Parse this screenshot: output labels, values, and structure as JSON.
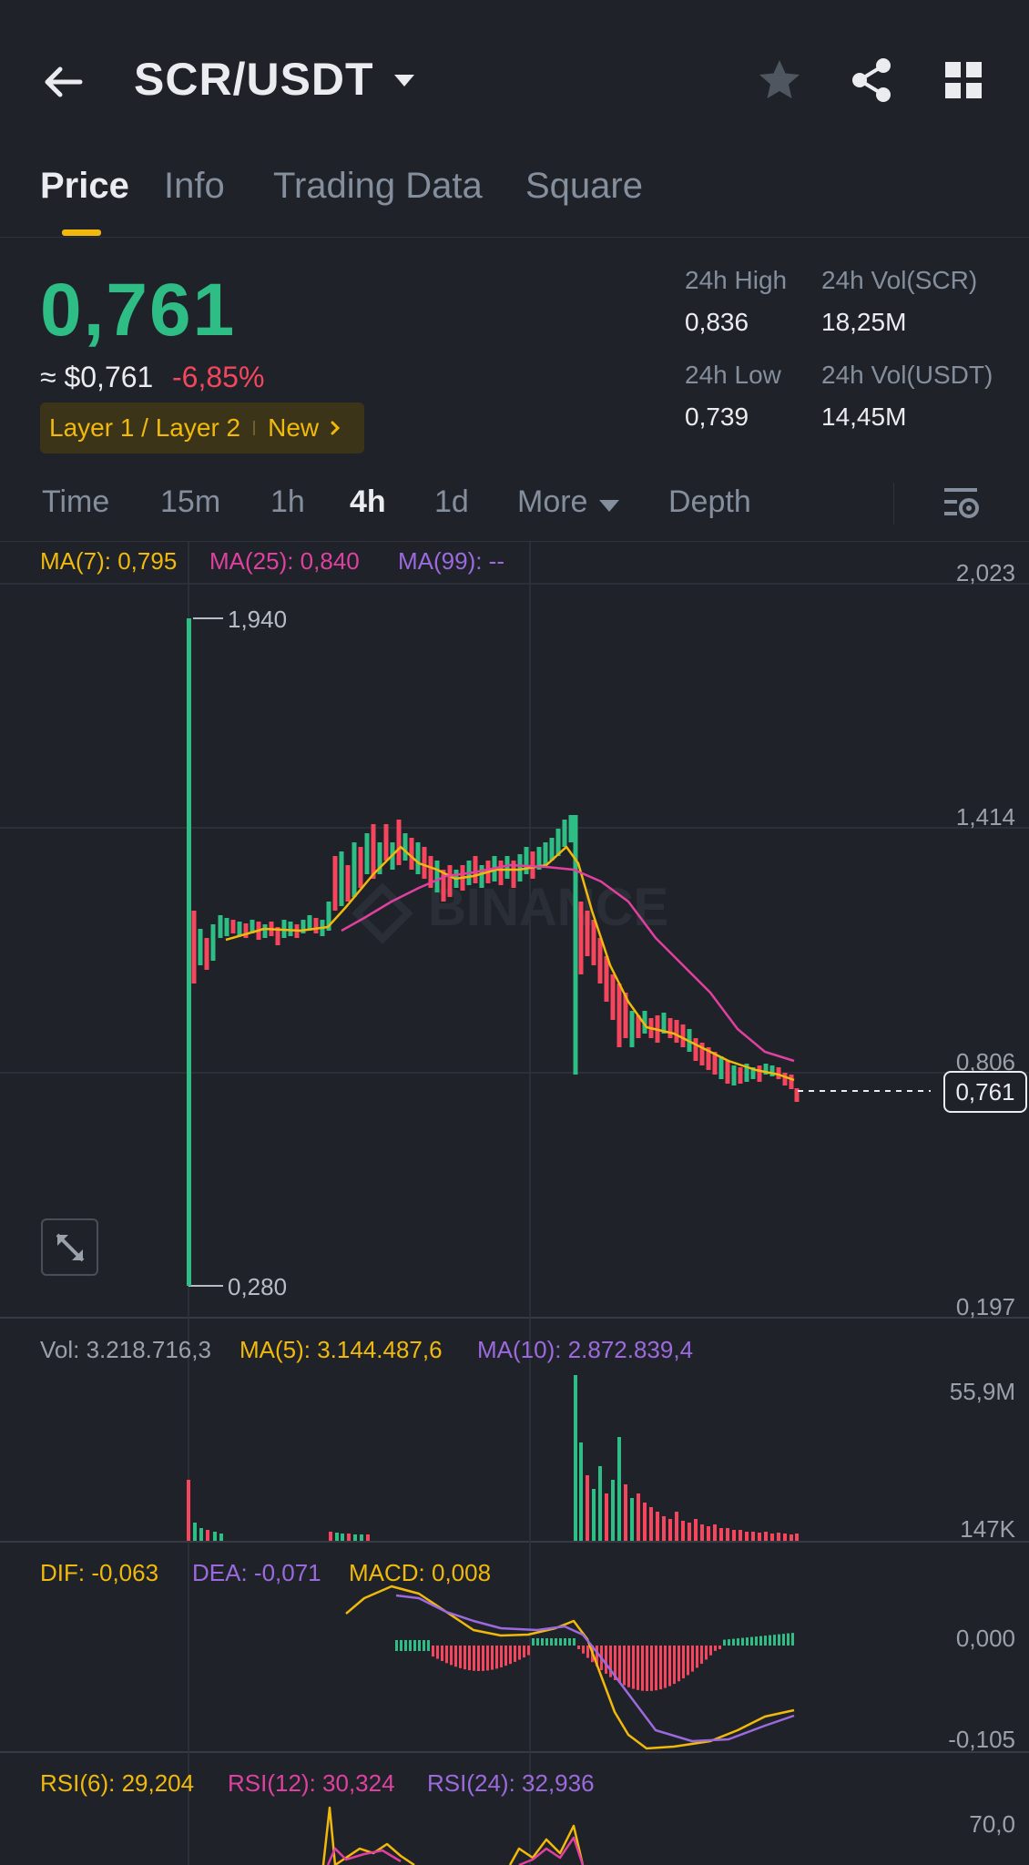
{
  "header": {
    "pair": "SCR/USDT",
    "icons": [
      "back-arrow-icon",
      "caret-down-icon",
      "star-icon",
      "share-icon",
      "grid-icon"
    ]
  },
  "tabs": [
    "Price",
    "Info",
    "Trading Data",
    "Square"
  ],
  "ticker": {
    "last_price": "0,761",
    "fiat_price": "≈ $0,761",
    "change": "-6,85%",
    "tag_category": "Layer 1 / Layer 2",
    "tag_new": "New",
    "high_label": "24h High",
    "high_value": "0,836",
    "vol_base_label": "24h Vol(SCR)",
    "vol_base_value": "18,25M",
    "low_label": "24h Low",
    "low_value": "0,739",
    "vol_quote_label": "24h Vol(USDT)",
    "vol_quote_value": "14,45M"
  },
  "intervals": [
    "Time",
    "15m",
    "1h",
    "4h",
    "1d",
    "More",
    "Depth"
  ],
  "active_interval": "4h",
  "main_chart": {
    "ma7": "MA(7): 0,795",
    "ma25": "MA(25): 0,840",
    "ma99": "MA(99): --",
    "axis_ticks": [
      "2,023",
      "1,414",
      "0,806",
      "0,197"
    ],
    "high_marker": "1,940",
    "low_marker": "0,280",
    "current_price": "0,761",
    "watermark": "BINANCE"
  },
  "volume": {
    "vol": "Vol: 3.218.716,3",
    "ma5": "MA(5): 3.144.487,6",
    "ma10": "MA(10): 2.872.839,4",
    "axis_ticks": [
      "55,9M",
      "147K"
    ]
  },
  "macd": {
    "dif": "DIF: -0,063",
    "dea": "DEA: -0,071",
    "macd": "MACD: 0,008",
    "axis_ticks": [
      "0,000",
      "-0,105"
    ]
  },
  "rsi": {
    "rsi6": "RSI(6): 29,204",
    "rsi12": "RSI(12): 30,324",
    "rsi24": "RSI(24): 32,936",
    "axis_ticks": [
      "70,0"
    ]
  },
  "colors": {
    "up": "#2ebd85",
    "down": "#f6465d",
    "accent": "#f0b90b",
    "ma7": "#f0b90b",
    "ma25": "#e040a0",
    "ma99": "#9c6ade"
  }
}
